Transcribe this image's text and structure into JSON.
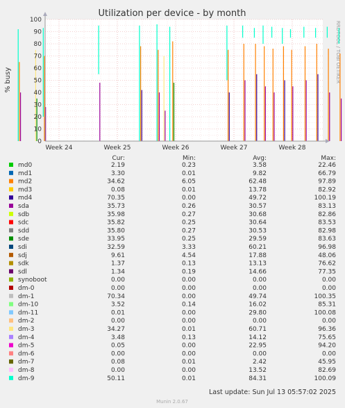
{
  "chart_data": {
    "type": "line",
    "title": "Utilization per device - by month",
    "ylabel": "% busy",
    "xlabel": "",
    "ylim": [
      0,
      100
    ],
    "y_ticks": [
      0,
      10,
      20,
      30,
      40,
      50,
      60,
      70,
      80,
      90,
      100
    ],
    "x_ticks": [
      "Week 24",
      "Week 25",
      "Week 26",
      "Week 27",
      "Week 28"
    ],
    "grid": true,
    "legend_placement": "bottom",
    "legend_headers": {
      "cur": "Cur:",
      "min": "Min:",
      "avg": "Avg:",
      "max": "Max:"
    },
    "series": [
      {
        "name": "md0",
        "color": "#00cc00",
        "cur": "2.19",
        "min": "0.23",
        "avg": "3.58",
        "max": "22.46"
      },
      {
        "name": "md1",
        "color": "#0066b3",
        "cur": "3.30",
        "min": "0.01",
        "avg": "9.82",
        "max": "66.79"
      },
      {
        "name": "md2",
        "color": "#ff8000",
        "cur": "34.62",
        "min": "6.05",
        "avg": "62.48",
        "max": "97.89"
      },
      {
        "name": "md3",
        "color": "#ffcc00",
        "cur": "0.08",
        "min": "0.01",
        "avg": "13.78",
        "max": "82.92"
      },
      {
        "name": "md4",
        "color": "#330099",
        "cur": "70.35",
        "min": "0.00",
        "avg": "49.72",
        "max": "100.19"
      },
      {
        "name": "sda",
        "color": "#990099",
        "cur": "35.73",
        "min": "0.26",
        "avg": "30.57",
        "max": "83.13"
      },
      {
        "name": "sdb",
        "color": "#ccff00",
        "cur": "35.98",
        "min": "0.27",
        "avg": "30.68",
        "max": "82.86"
      },
      {
        "name": "sdc",
        "color": "#ff0000",
        "cur": "35.82",
        "min": "0.25",
        "avg": "30.64",
        "max": "83.53"
      },
      {
        "name": "sdd",
        "color": "#808080",
        "cur": "35.80",
        "min": "0.27",
        "avg": "30.53",
        "max": "82.98"
      },
      {
        "name": "sde",
        "color": "#008f00",
        "cur": "33.95",
        "min": "0.25",
        "avg": "29.59",
        "max": "83.63"
      },
      {
        "name": "sdi",
        "color": "#00487d",
        "cur": "32.59",
        "min": "3.33",
        "avg": "60.21",
        "max": "96.98"
      },
      {
        "name": "sdj",
        "color": "#b35a00",
        "cur": "9.61",
        "min": "4.54",
        "avg": "17.88",
        "max": "48.06"
      },
      {
        "name": "sdk",
        "color": "#b38f00",
        "cur": "1.37",
        "min": "0.13",
        "avg": "13.13",
        "max": "76.62"
      },
      {
        "name": "sdl",
        "color": "#6b006b",
        "cur": "1.34",
        "min": "0.19",
        "avg": "14.66",
        "max": "77.35"
      },
      {
        "name": "synoboot",
        "color": "#8fb300",
        "cur": "0.00",
        "min": "0.00",
        "avg": "0.00",
        "max": "0.00"
      },
      {
        "name": "dm-0",
        "color": "#b30000",
        "cur": "0.00",
        "min": "0.00",
        "avg": "0.00",
        "max": "0.00"
      },
      {
        "name": "dm-1",
        "color": "#bebebe",
        "cur": "70.34",
        "min": "0.00",
        "avg": "49.74",
        "max": "100.35"
      },
      {
        "name": "dm-10",
        "color": "#80ff80",
        "cur": "3.52",
        "min": "0.14",
        "avg": "16.02",
        "max": "85.31"
      },
      {
        "name": "dm-11",
        "color": "#80c9ff",
        "cur": "0.01",
        "min": "0.00",
        "avg": "29.80",
        "max": "100.08"
      },
      {
        "name": "dm-2",
        "color": "#ffc080",
        "cur": "0.00",
        "min": "0.00",
        "avg": "0.00",
        "max": "0.00"
      },
      {
        "name": "dm-3",
        "color": "#ffe680",
        "cur": "34.27",
        "min": "0.01",
        "avg": "60.71",
        "max": "96.36"
      },
      {
        "name": "dm-4",
        "color": "#aa80ff",
        "cur": "3.48",
        "min": "0.13",
        "avg": "14.12",
        "max": "75.65"
      },
      {
        "name": "dm-5",
        "color": "#ee00cc",
        "cur": "0.05",
        "min": "0.00",
        "avg": "22.95",
        "max": "94.20"
      },
      {
        "name": "dm-6",
        "color": "#ff8080",
        "cur": "0.00",
        "min": "0.00",
        "avg": "0.00",
        "max": "0.00"
      },
      {
        "name": "dm-7",
        "color": "#666600",
        "cur": "0.08",
        "min": "0.01",
        "avg": "2.42",
        "max": "45.95"
      },
      {
        "name": "dm-8",
        "color": "#ffbfff",
        "cur": "0.00",
        "min": "0.00",
        "avg": "13.52",
        "max": "82.69"
      },
      {
        "name": "dm-9",
        "color": "#00ffcc",
        "cur": "50.11",
        "min": "0.01",
        "avg": "84.31",
        "max": "100.09"
      }
    ],
    "spikes": [
      {
        "week": 23.3,
        "low": 0,
        "high": 92,
        "series": "dm-9"
      },
      {
        "week": 23.32,
        "low": 0,
        "high": 65,
        "series": "md2"
      },
      {
        "week": 23.34,
        "low": 0,
        "high": 40,
        "series": "sda"
      },
      {
        "week": 23.6,
        "low": 0,
        "high": 75,
        "series": "dm-3"
      },
      {
        "week": 23.62,
        "low": 0,
        "high": 35,
        "series": "sde"
      },
      {
        "week": 23.73,
        "low": 20,
        "high": 93,
        "series": "dm-9"
      },
      {
        "week": 23.75,
        "low": 0,
        "high": 70,
        "series": "md2"
      },
      {
        "week": 23.77,
        "low": 0,
        "high": 28,
        "series": "sda"
      },
      {
        "week": 24.68,
        "low": 55,
        "high": 95,
        "series": "dm-9"
      },
      {
        "week": 24.7,
        "low": 0,
        "high": 48,
        "series": "sda"
      },
      {
        "week": 25.38,
        "low": 0,
        "high": 95,
        "series": "dm-9"
      },
      {
        "week": 25.4,
        "low": 0,
        "high": 78,
        "series": "md2"
      },
      {
        "week": 25.42,
        "low": 0,
        "high": 42,
        "series": "md4"
      },
      {
        "week": 25.68,
        "low": 0,
        "high": 96,
        "series": "dm-9"
      },
      {
        "week": 25.7,
        "low": 0,
        "high": 75,
        "series": "md2"
      },
      {
        "week": 25.72,
        "low": 0,
        "high": 40,
        "series": "sda"
      },
      {
        "week": 25.8,
        "low": 0,
        "high": 70,
        "series": "dm-3"
      },
      {
        "week": 25.82,
        "low": 0,
        "high": 25,
        "series": "sda"
      },
      {
        "week": 25.9,
        "low": 0,
        "high": 94,
        "series": "dm-9"
      },
      {
        "week": 25.95,
        "low": 0,
        "high": 82,
        "series": "md2"
      },
      {
        "week": 25.97,
        "low": 0,
        "high": 48,
        "series": "sde"
      },
      {
        "week": 26.88,
        "low": 50,
        "high": 95,
        "series": "dm-9"
      },
      {
        "week": 26.9,
        "low": 0,
        "high": 75,
        "series": "md2"
      },
      {
        "week": 26.92,
        "low": 0,
        "high": 40,
        "series": "md4"
      },
      {
        "week": 27.15,
        "low": 85,
        "high": 95,
        "series": "dm-9"
      },
      {
        "week": 27.17,
        "low": 0,
        "high": 80,
        "series": "md2"
      },
      {
        "week": 27.19,
        "low": 0,
        "high": 50,
        "series": "sda"
      },
      {
        "week": 27.35,
        "low": 85,
        "high": 93,
        "series": "dm-9"
      },
      {
        "week": 27.37,
        "low": 0,
        "high": 80,
        "series": "md2"
      },
      {
        "week": 27.39,
        "low": 0,
        "high": 55,
        "series": "md4"
      },
      {
        "week": 27.5,
        "low": 80,
        "high": 95,
        "series": "dm-9"
      },
      {
        "week": 27.52,
        "low": 0,
        "high": 78,
        "series": "md2"
      },
      {
        "week": 27.54,
        "low": 0,
        "high": 45,
        "series": "sda"
      },
      {
        "week": 27.65,
        "low": 85,
        "high": 94,
        "series": "dm-9"
      },
      {
        "week": 27.67,
        "low": 0,
        "high": 76,
        "series": "md2"
      },
      {
        "week": 27.69,
        "low": 0,
        "high": 40,
        "series": "sda"
      },
      {
        "week": 27.83,
        "low": 80,
        "high": 93,
        "series": "dm-9"
      },
      {
        "week": 27.85,
        "low": 0,
        "high": 78,
        "series": "md2"
      },
      {
        "week": 27.87,
        "low": 0,
        "high": 50,
        "series": "md4"
      },
      {
        "week": 27.97,
        "low": 85,
        "high": 92,
        "series": "dm-9"
      },
      {
        "week": 27.99,
        "low": 0,
        "high": 75,
        "series": "md2"
      },
      {
        "week": 28.01,
        "low": 0,
        "high": 45,
        "series": "sda"
      },
      {
        "week": 28.2,
        "low": 85,
        "high": 94,
        "series": "dm-9"
      },
      {
        "week": 28.22,
        "low": 0,
        "high": 78,
        "series": "md2"
      },
      {
        "week": 28.24,
        "low": 0,
        "high": 50,
        "series": "sda"
      },
      {
        "week": 28.4,
        "low": 85,
        "high": 93,
        "series": "dm-9"
      },
      {
        "week": 28.42,
        "low": 0,
        "high": 80,
        "series": "md2"
      },
      {
        "week": 28.44,
        "low": 0,
        "high": 55,
        "series": "md4"
      },
      {
        "week": 28.6,
        "low": 85,
        "high": 94,
        "series": "dm-9"
      },
      {
        "week": 28.62,
        "low": 0,
        "high": 76,
        "series": "md2"
      },
      {
        "week": 28.64,
        "low": 0,
        "high": 40,
        "series": "sda"
      },
      {
        "week": 28.8,
        "low": 80,
        "high": 93,
        "series": "dm-9"
      },
      {
        "week": 28.82,
        "low": 0,
        "high": 72,
        "series": "md2"
      },
      {
        "week": 28.84,
        "low": 0,
        "high": 35,
        "series": "sda"
      }
    ]
  },
  "side_label": "RRDTOOL / TOBI OETIKER",
  "footer": {
    "last_update": "Last update: Sun Jul 13 05:57:02 2025",
    "version": "Munin 2.0.67"
  }
}
